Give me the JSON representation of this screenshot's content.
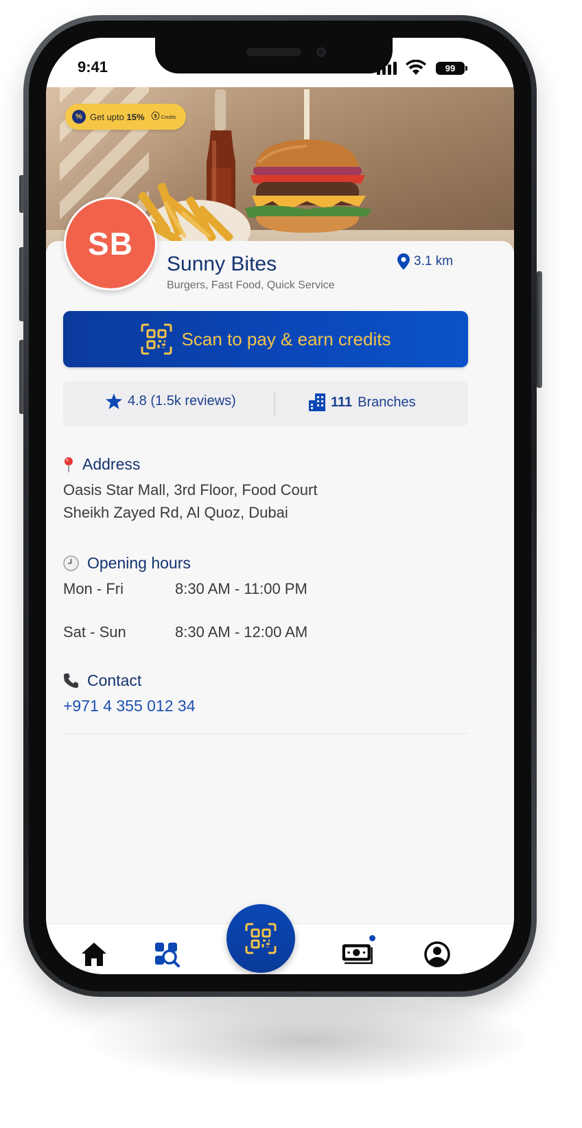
{
  "status_bar": {
    "time": "9:41",
    "battery": "99",
    "icons": [
      "signal-icon",
      "wifi-icon",
      "battery-icon"
    ]
  },
  "hero": {
    "promo": {
      "prefix": "Get upto",
      "percent": "15%",
      "brand": "Credits"
    }
  },
  "business": {
    "initials": "SB",
    "name": "Sunny Bites",
    "categories": "Burgers, Fast Food, Quick Service",
    "distance": "3.1 km"
  },
  "scan_button": {
    "label": "Scan to pay & earn credits"
  },
  "stats": {
    "rating": "4.8 (1.5k reviews)",
    "branches_count": "111",
    "branches_label": "Branches"
  },
  "address": {
    "heading": "Address",
    "line1": "Oasis Star Mall, 3rd Floor, Food Court",
    "line2": "Sheikh Zayed Rd, Al Quoz, Dubai"
  },
  "hours": {
    "heading": "Opening hours",
    "rows": [
      {
        "days": "Mon - Fri",
        "time": "8:30 AM - 11:00 PM"
      },
      {
        "days": "Sat - Sun",
        "time": "8:30 AM - 12:00 AM"
      }
    ]
  },
  "contact": {
    "heading": "Contact",
    "phone": "+971 4 355 012 34"
  },
  "tab_bar": {
    "tabs": [
      "home-icon",
      "store-search-icon",
      "qr-scan-icon",
      "wallet-icon",
      "profile-icon"
    ]
  },
  "colors": {
    "primary": "#0b47b5",
    "heading": "#13336f",
    "accent_gold": "#f4c44a",
    "avatar": "#f0624c",
    "promo_pill": "#f6c744"
  }
}
